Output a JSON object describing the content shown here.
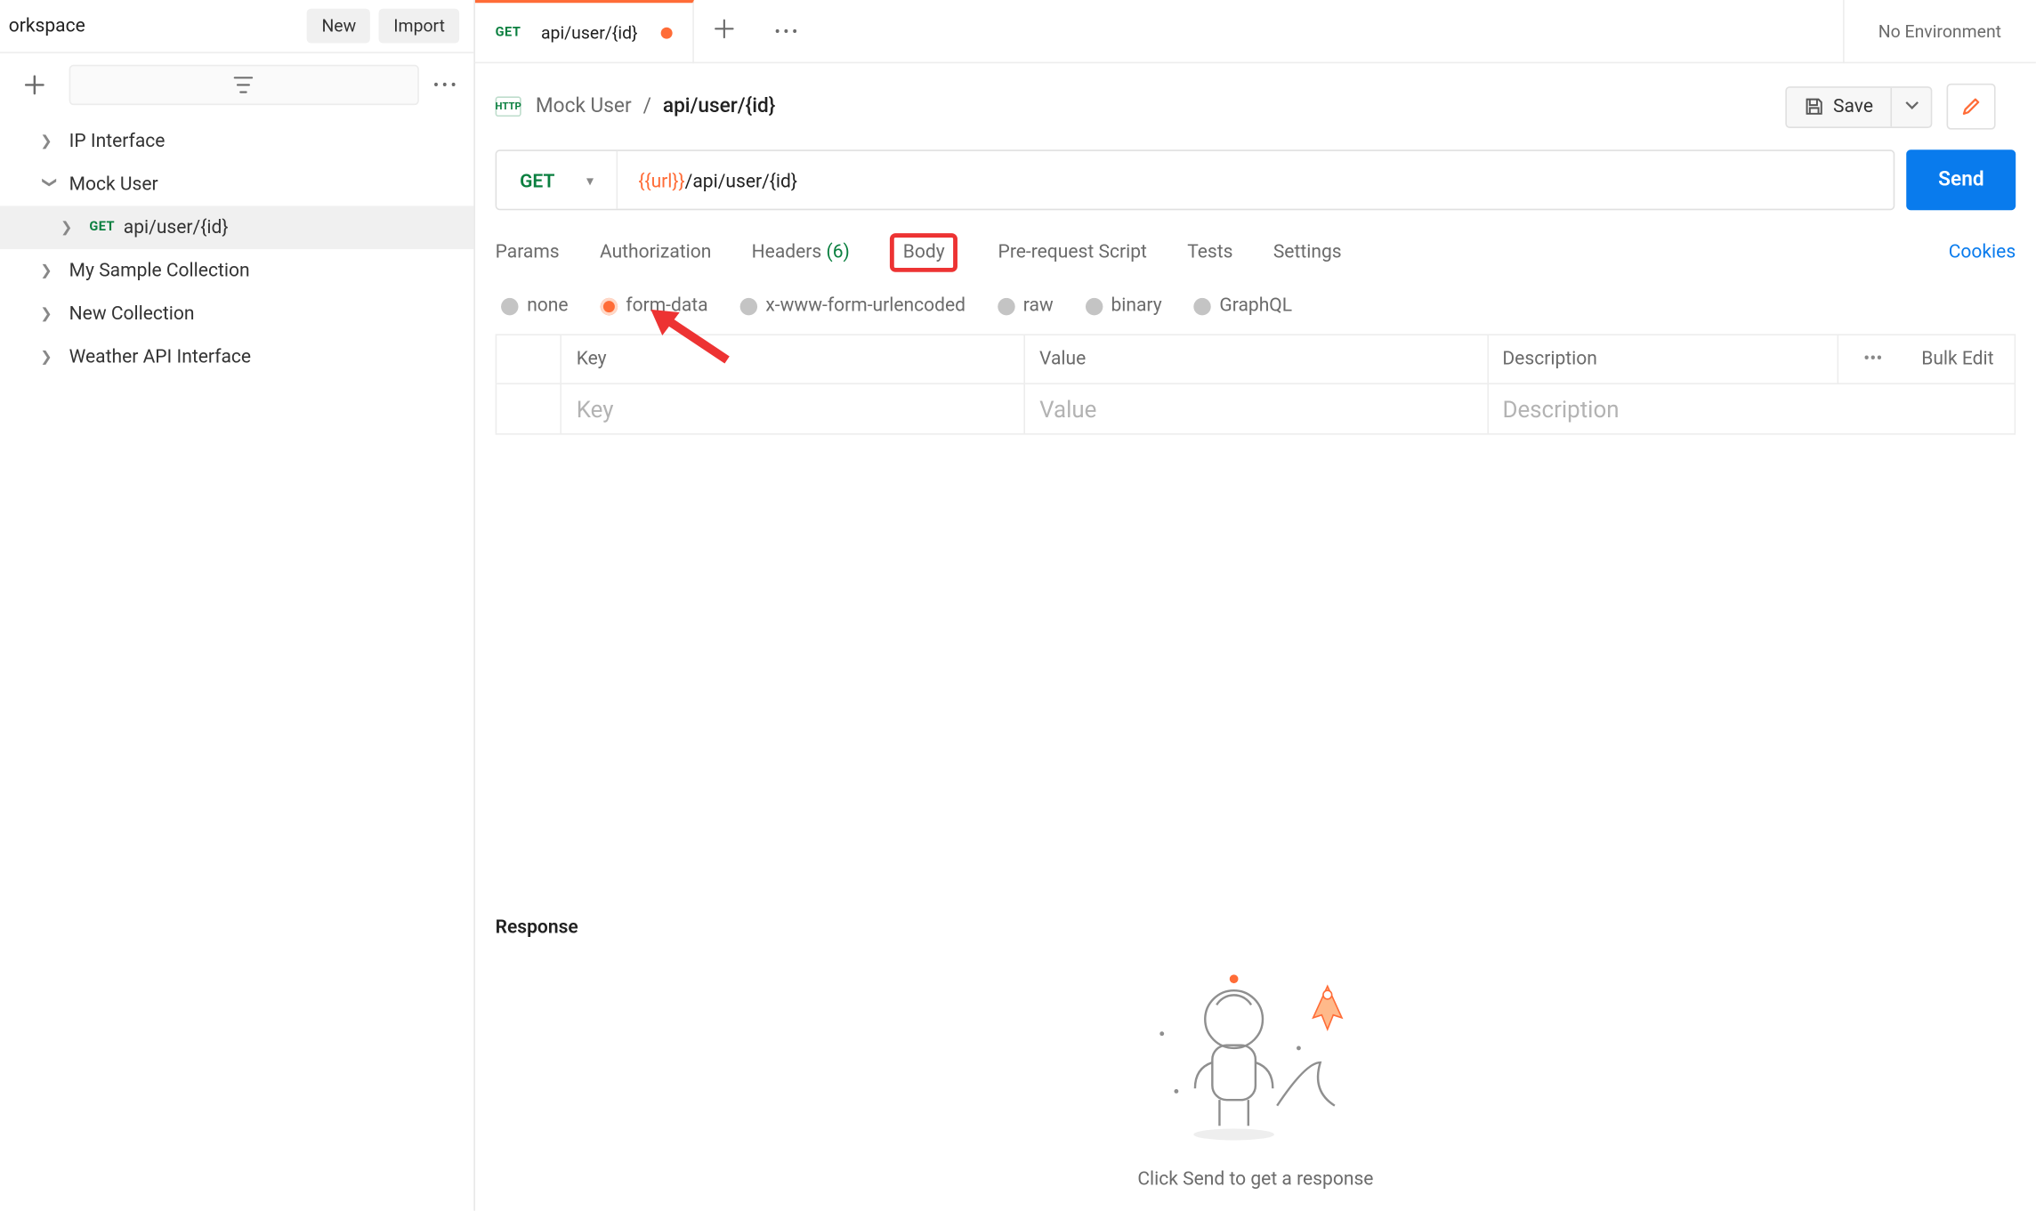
{
  "sidebar": {
    "workspace_label": "orkspace",
    "new_btn": "New",
    "import_btn": "Import",
    "collections": [
      {
        "name": "IP Interface",
        "expanded": false
      },
      {
        "name": "Mock User",
        "expanded": true,
        "children": [
          {
            "method": "GET",
            "name": "api/user/{id}",
            "selected": true
          }
        ]
      },
      {
        "name": "My Sample Collection",
        "expanded": false
      },
      {
        "name": "New Collection",
        "expanded": false
      },
      {
        "name": "Weather API Interface",
        "expanded": false
      }
    ]
  },
  "tab": {
    "method": "GET",
    "title": "api/user/{id}"
  },
  "env": {
    "label": "No Environment"
  },
  "breadcrumb": {
    "parent": "Mock User",
    "sep": "/",
    "current": "api/user/{id}"
  },
  "actions": {
    "save": "Save"
  },
  "request": {
    "method": "GET",
    "url_var": "{{url}}",
    "url_path": "/api/user/{id}",
    "send": "Send"
  },
  "reqtabs": {
    "params": "Params",
    "auth": "Authorization",
    "headers": "Headers",
    "headers_count": "(6)",
    "body": "Body",
    "prereq": "Pre-request Script",
    "tests": "Tests",
    "settings": "Settings",
    "cookies": "Cookies"
  },
  "bodytypes": {
    "none": "none",
    "formdata": "form-data",
    "urlenc": "x-www-form-urlencoded",
    "raw": "raw",
    "binary": "binary",
    "graphql": "GraphQL"
  },
  "table": {
    "head_key": "Key",
    "head_value": "Value",
    "head_desc": "Description",
    "bulk": "Bulk Edit",
    "ph_key": "Key",
    "ph_value": "Value",
    "ph_desc": "Description"
  },
  "response": {
    "title": "Response",
    "hint": "Click Send to get a response"
  }
}
